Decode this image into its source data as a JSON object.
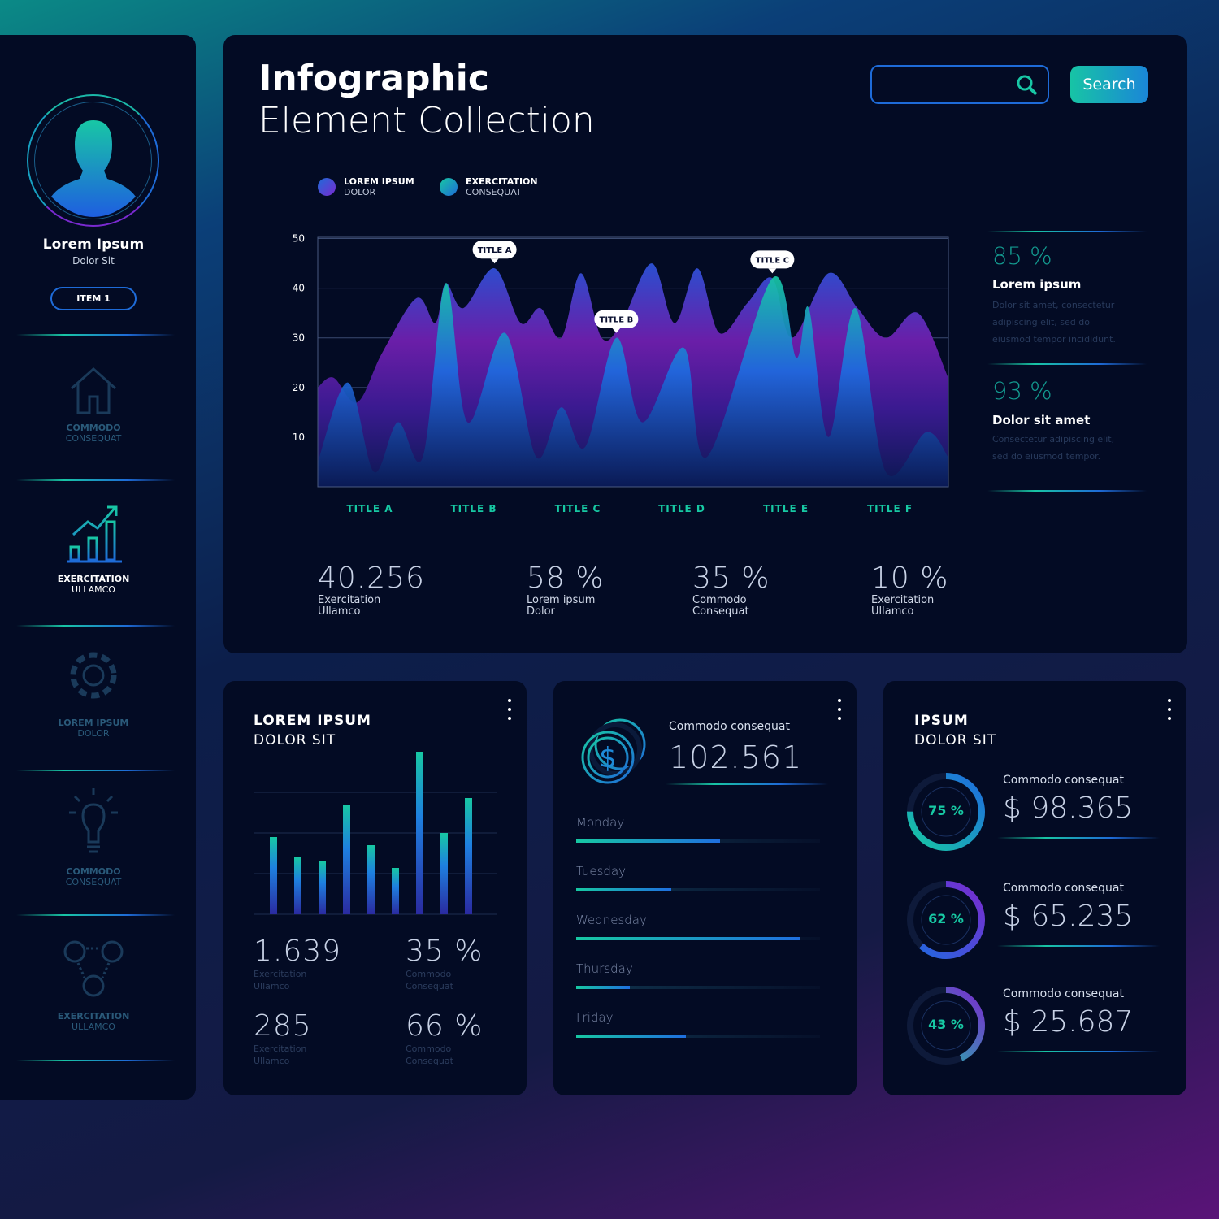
{
  "sidebar": {
    "profile": {
      "name": "Lorem Ipsum",
      "subtitle": "Dolor Sit",
      "button": "ITEM 1",
      "icon": "user-avatar-icon"
    },
    "items": [
      {
        "icon": "home-icon",
        "line1": "COMMODO",
        "line2": "CONSEQUAT",
        "active": false
      },
      {
        "icon": "growth-chart-icon",
        "line1": "EXERCITATION",
        "line2": "ULLAMCO",
        "active": true
      },
      {
        "icon": "gear-icon",
        "line1": "LOREM IPSUM",
        "line2": "DOLOR",
        "active": false
      },
      {
        "icon": "lightbulb-icon",
        "line1": "COMMODO",
        "line2": "CONSEQUAT",
        "active": false
      },
      {
        "icon": "team-icon",
        "line1": "EXERCITATION",
        "line2": "ULLAMCO",
        "active": false
      }
    ]
  },
  "header": {
    "title_bold": "Infographic",
    "title_light": "Element Collection",
    "search_placeholder": "",
    "search_button": "Search"
  },
  "legend": [
    {
      "line1": "LOREM IPSUM",
      "line2": "DOLOR",
      "color": "#7a2ad0"
    },
    {
      "line1": "EXERCITATION",
      "line2": "CONSEQUAT",
      "color": "#17c8a3"
    }
  ],
  "chart_data": {
    "type": "area",
    "x_categories": [
      "TITLE A",
      "TITLE B",
      "TITLE C",
      "TITLE D",
      "TITLE E",
      "TITLE F"
    ],
    "yticks": [
      10,
      20,
      30,
      40,
      50
    ],
    "ylim": [
      0,
      50
    ],
    "grid": true,
    "legend_position": "top-left",
    "series": [
      {
        "name": "LOREM IPSUM DOLOR",
        "points": [
          [
            -0.5,
            20
          ],
          [
            -0.35,
            22
          ],
          [
            -0.12,
            17
          ],
          [
            0.12,
            27
          ],
          [
            0.45,
            38
          ],
          [
            0.63,
            33
          ],
          [
            0.73,
            41
          ],
          [
            0.9,
            36
          ],
          [
            1.2,
            44
          ],
          [
            1.45,
            33
          ],
          [
            1.64,
            36
          ],
          [
            1.84,
            30
          ],
          [
            2.03,
            43
          ],
          [
            2.23,
            30
          ],
          [
            2.42,
            33
          ],
          [
            2.71,
            45
          ],
          [
            2.93,
            33
          ],
          [
            3.15,
            44
          ],
          [
            3.36,
            31
          ],
          [
            3.63,
            37
          ],
          [
            3.87,
            42
          ],
          [
            4.06,
            30
          ],
          [
            4.41,
            43
          ],
          [
            4.69,
            36
          ],
          [
            4.96,
            30
          ],
          [
            5.27,
            35
          ],
          [
            5.56,
            22
          ]
        ]
      },
      {
        "name": "EXERCITATION CONSEQUAT",
        "points": [
          [
            -0.5,
            5
          ],
          [
            -0.21,
            21
          ],
          [
            0.04,
            3
          ],
          [
            0.27,
            13
          ],
          [
            0.51,
            6
          ],
          [
            0.73,
            41
          ],
          [
            0.94,
            13
          ],
          [
            1.3,
            31
          ],
          [
            1.6,
            6
          ],
          [
            1.84,
            16
          ],
          [
            2.07,
            8
          ],
          [
            2.37,
            30
          ],
          [
            2.62,
            13
          ],
          [
            3.02,
            28
          ],
          [
            3.24,
            6
          ],
          [
            3.87,
            42
          ],
          [
            4.1,
            26
          ],
          [
            4.22,
            36
          ],
          [
            4.41,
            10
          ],
          [
            4.67,
            36
          ],
          [
            4.96,
            3
          ],
          [
            5.35,
            11
          ],
          [
            5.56,
            6
          ]
        ]
      }
    ],
    "annotations": [
      {
        "text": "TITLE A",
        "x": 1.2,
        "y": 44
      },
      {
        "text": "TITLE B",
        "x": 2.37,
        "y": 30
      },
      {
        "text": "TITLE C",
        "x": 3.87,
        "y": 42
      }
    ]
  },
  "side_stats": [
    {
      "value": "85 %",
      "title": "Lorem ipsum",
      "text": "Dolor sit amet, consectetur adipiscing elit, sed do eiusmod tempor incididunt."
    },
    {
      "value": "93 %",
      "title": "Dolor sit amet",
      "text": "Consectetur adipiscing elit, sed do eiusmod tempor."
    }
  ],
  "bottom_stats": [
    {
      "value": "40.256",
      "line1": "Exercitation",
      "line2": "Ullamco"
    },
    {
      "value": "58 %",
      "line1": "Lorem ipsum",
      "line2": "Dolor"
    },
    {
      "value": "35 %",
      "line1": "Commodo",
      "line2": "Consequat"
    },
    {
      "value": "10 %",
      "line1": "Exercitation",
      "line2": "Ullamco"
    }
  ],
  "card1": {
    "title1": "LOREM IPSUM",
    "title2": "DOLOR SIT",
    "bars": [
      95,
      70,
      65,
      135,
      85,
      57,
      200,
      100,
      143
    ],
    "stats": [
      {
        "value": "1.639",
        "line1": "Exercitation",
        "line2": "Ullamco"
      },
      {
        "value": "35 %",
        "line1": "Commodo",
        "line2": "Consequat"
      },
      {
        "value": "285",
        "line1": "Exercitation",
        "line2": "Ullamco"
      },
      {
        "value": "66 %",
        "line1": "Commodo",
        "line2": "Consequat"
      }
    ]
  },
  "card2": {
    "label": "Commodo consequat",
    "value": "102.561",
    "icon": "dollar-coins-icon",
    "days": [
      {
        "day": "Monday",
        "progress": 0.59
      },
      {
        "day": "Tuesday",
        "progress": 0.39
      },
      {
        "day": "Wednesday",
        "progress": 0.92
      },
      {
        "day": "Thursday",
        "progress": 0.22
      },
      {
        "day": "Friday",
        "progress": 0.45
      }
    ]
  },
  "card3": {
    "title1": "IPSUM",
    "title2": "DOLOR SIT",
    "rows": [
      {
        "percent": "75 %",
        "fraction": 0.75,
        "label": "Commodo consequat",
        "amount": "$ 98.365"
      },
      {
        "percent": "62 %",
        "fraction": 0.62,
        "label": "Commodo consequat",
        "amount": "$ 65.235"
      },
      {
        "percent": "43 %",
        "fraction": 0.43,
        "label": "Commodo consequat",
        "amount": "$ 25.687"
      }
    ]
  }
}
